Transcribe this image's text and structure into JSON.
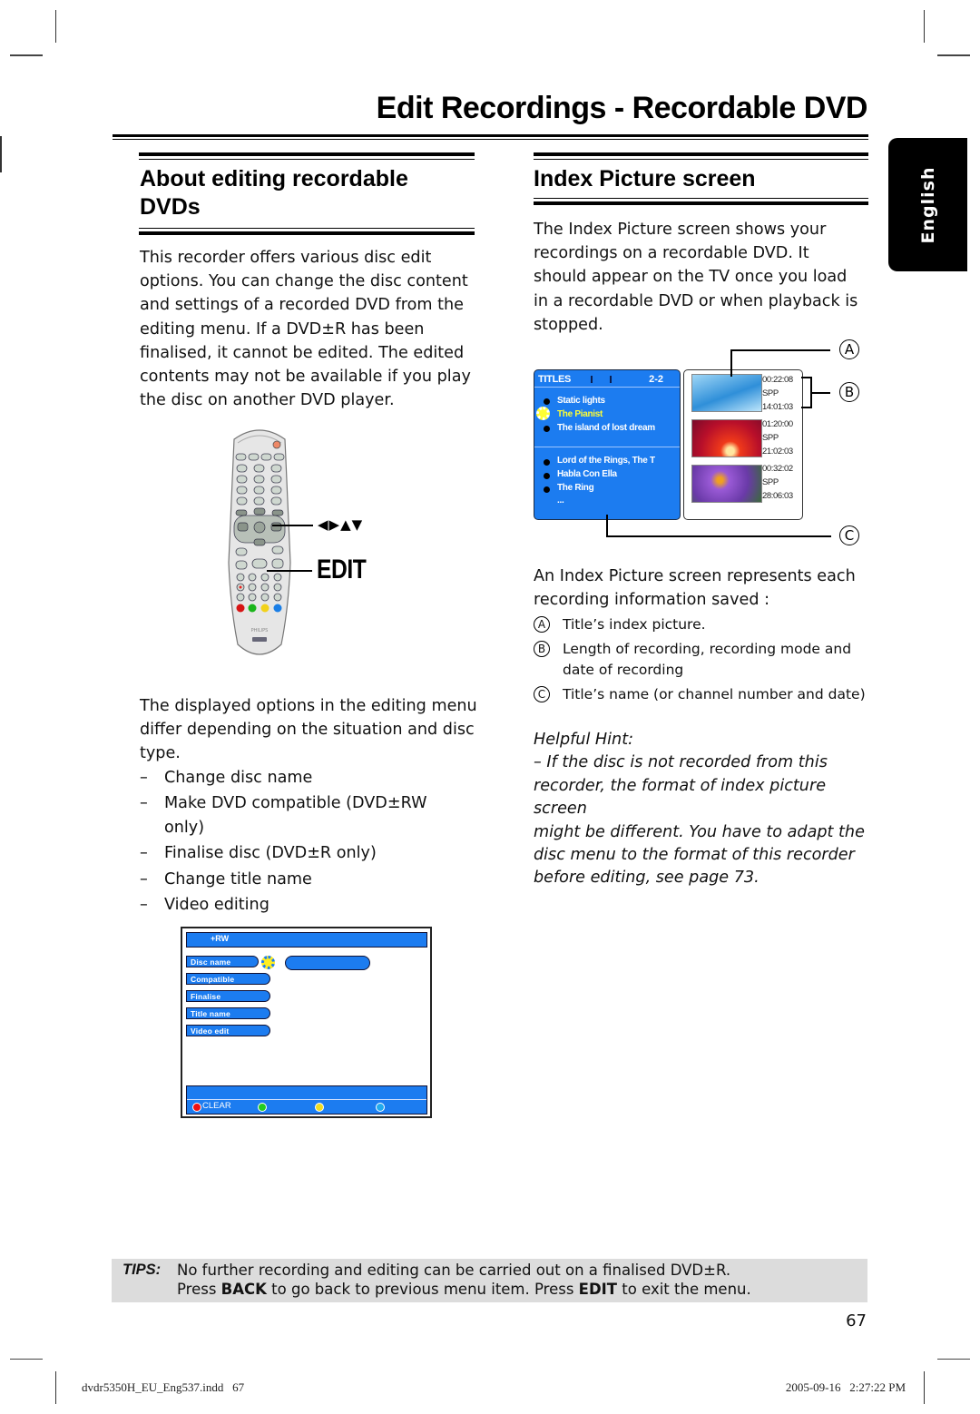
{
  "page": {
    "title": "Edit Recordings - Recordable DVD",
    "language_tab": "English",
    "page_number": "67"
  },
  "left": {
    "heading_line1": "About editing recordable",
    "heading_line2": "DVDs",
    "intro": [
      "This recorder offers various disc edit",
      "options. You can change the disc content",
      "and settings of a recorded DVD from the",
      "editing menu. If a DVD±R has been",
      "finalised, it cannot be edited. The edited",
      "contents may not be available if you play",
      "the disc on another DVD player."
    ],
    "remote": {
      "arrows_label": "◀▶▲▼",
      "edit_label": "EDIT",
      "brand": "PHILIPS"
    },
    "options_intro": [
      "The displayed options in the editing menu",
      "differ depending on the situation and disc",
      "type."
    ],
    "options": [
      {
        "dash": "–",
        "text": "Change disc name"
      },
      {
        "dash": "–",
        "text": "Make DVD compatible (DVD±RW only)"
      },
      {
        "dash": "–",
        "text": "Finalise disc (DVD±R only)"
      },
      {
        "dash": "–",
        "text": "Change title name"
      },
      {
        "dash": "–",
        "text": "Video editing"
      }
    ],
    "edit_menu": {
      "disc_type": "+RW",
      "items": [
        "Disc name",
        "Compatible",
        "Finalise",
        "Title name",
        "Video edit"
      ],
      "clear_label": "CLEAR",
      "colors": {
        "red": "#ee1111",
        "green": "#22cc22",
        "yellow": "#eedd22",
        "blue": "#22aaee",
        "panel": "#1c7cf0"
      }
    }
  },
  "right": {
    "heading": "Index Picture screen",
    "intro": [
      "The Index Picture screen shows your",
      "recordings on a recordable DVD.  It",
      "should appear on the TV once you load",
      "in a recordable DVD or when playback is",
      "stopped."
    ],
    "index_screen": {
      "header": "TITLES",
      "page": "2-2",
      "group1": [
        "Static lights",
        "The Pianist",
        "The island of lost dream"
      ],
      "selected": "The Pianist",
      "group2": [
        "Lord of the Rings, The T",
        "Habla Con Ella",
        "The Ring",
        "..."
      ],
      "thumbnails": [
        {
          "length": "00:22:08",
          "mode": "SPP",
          "date": "14:01:03"
        },
        {
          "length": "01:20:00",
          "mode": "SPP",
          "date": "21:02:03"
        },
        {
          "length": "00:32:02",
          "mode": "SPP",
          "date": "28:06:03"
        }
      ],
      "callouts": [
        "A",
        "B",
        "C"
      ]
    },
    "desc_line1": "An Index Picture screen represents each",
    "desc_line2": "recording information saved :",
    "legend": [
      {
        "key": "A",
        "text": "Title’s index picture."
      },
      {
        "key": "B",
        "text": "Length of recording, recording mode and",
        "text2": "date of recording"
      },
      {
        "key": "C",
        "text": "Title’s name (or channel number and date)"
      }
    ],
    "hint_title": "Helpful Hint:",
    "hint_lines": [
      "– If the disc is not recorded from this",
      "recorder, the format of index picture screen",
      "might be different. You have to adapt the",
      "disc menu to the format of this recorder",
      "before editing, see page 73."
    ]
  },
  "tips": {
    "label": "TIPS:",
    "line1": "No further recording and editing can be carried out on a finalised DVD±R.",
    "line2_pre": "Press ",
    "line2_b1": "BACK",
    "line2_mid": " to go back to previous menu item. Press ",
    "line2_b2": "EDIT",
    "line2_post": " to exit the menu."
  },
  "footer": {
    "file": "dvdr5350H_EU_Eng537.indd   67",
    "timestamp": "2005-09-16   2:27:22 PM"
  }
}
